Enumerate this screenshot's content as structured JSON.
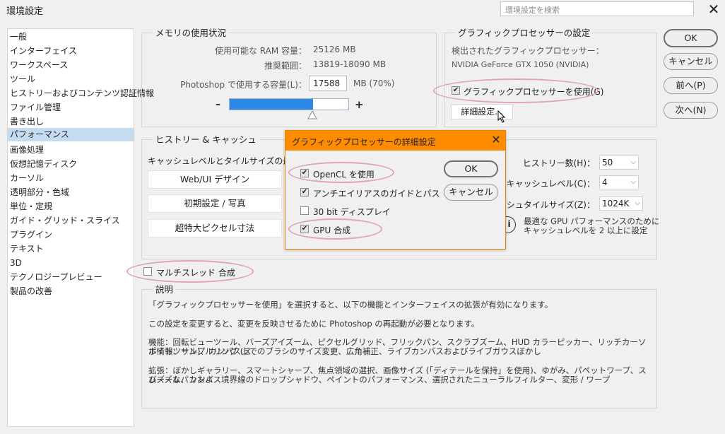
{
  "window": {
    "title": "環境設定",
    "search_placeholder": "環境設定を検索"
  },
  "sidebar": {
    "items": [
      {
        "label": "一般"
      },
      {
        "label": "インターフェイス"
      },
      {
        "label": "ワークスペース"
      },
      {
        "label": "ツール"
      },
      {
        "label": "ヒストリーおよびコンテンツ認証情報"
      },
      {
        "label": "ファイル管理"
      },
      {
        "label": "書き出し"
      },
      {
        "label": "パフォーマンス",
        "selected": true
      },
      {
        "label": "画像処理"
      },
      {
        "label": "仮想記憶ディスク"
      },
      {
        "label": "カーソル"
      },
      {
        "label": "透明部分・色域"
      },
      {
        "label": "単位・定規"
      },
      {
        "label": "ガイド・グリッド・スライス"
      },
      {
        "label": "プラグイン"
      },
      {
        "label": "テキスト"
      },
      {
        "label": "3D"
      },
      {
        "label": "テクノロジープレビュー"
      },
      {
        "label": "製品の改善"
      }
    ]
  },
  "memory": {
    "title": "メモリの使用状況",
    "available_label": "使用可能な RAM 容量：",
    "available_value": "25126 MB",
    "range_label": "推奨範囲：",
    "range_value": "13819-18090 MB",
    "use_label": "Photoshop で使用する容量(L)：",
    "use_value": "17588",
    "use_unit": "MB (70%)",
    "minus": "–",
    "plus": "+",
    "slider_fraction": 0.7
  },
  "gpu": {
    "title": "グラフィックプロセッサーの設定",
    "detected_label": "検出されたグラフィックプロセッサー：",
    "device": "NVIDIA GeForce GTX 1050 (NVIDIA)",
    "use_gpu_label": "グラフィックプロセッサーを使用(G)",
    "use_gpu_checked": true,
    "advanced_button": "詳細設定..."
  },
  "history": {
    "title": "ヒストリー & キャッシュ",
    "intro": "キャッシュレベルとタイルサイズの最適",
    "buttons": [
      "Web/UI デザイン",
      "初期設定 / 写真",
      "超特大ピクセル寸法"
    ],
    "states_label": "ヒストリー数(H)：",
    "states_value": "50",
    "cache_levels_label": "キャッシュレベル(C)：",
    "cache_levels_value": "4",
    "tile_size_label": "ャッシュタイルサイズ(Z)：",
    "tile_size_value": "1024K",
    "info_icon_glyph": "i",
    "gpu_note_1": "最適な GPU パフォーマンスのために",
    "gpu_note_2": "キャッシュレベルを 2 以上に設定"
  },
  "multithread": {
    "label": "マルチスレッド 合成",
    "checked": false
  },
  "description": {
    "title": "説明",
    "lines": [
      "「グラフィックプロセッサーを使用」を選択すると、以下の機能とインターフェイスの拡張が有効になります。",
      "この設定を変更すると、変更を反映させるために Photoshop の再起動が必要となります。",
      "機能：回転ビューツール、バーズアイズーム、ピクセルグリッド、フリックパン、スクラブズーム、HUD カラーピッカー、リッチカーソル情報、サンプルリング (ス",
      "ポイトツール)、カンバス上でのブラシのサイズ変更、広角補正、ライブカンバスおよびライブガウスぼかし",
      "拡張：ぼかしギャラリー、スマートシャープ、焦点領域の選択、画像サイズ (「ディテールを保持」を使用)、ゆがみ、パペットワープ、スムーズなパンおよ",
      "びズーム、カンバス境界線のドロップシャドウ、ペイントのパフォーマンス、選択されたニューラルフィルター、変形 / ワープ"
    ]
  },
  "buttons": {
    "ok": "OK",
    "cancel": "キャンセル",
    "prev": "前へ(P)",
    "next": "次へ(N)"
  },
  "dialog": {
    "title": "グラフィックプロセッサーの詳細設定",
    "options": [
      {
        "label": "OpenCL を使用",
        "checked": true
      },
      {
        "label": "アンチエイリアスのガイドとパス",
        "checked": true
      },
      {
        "label": "30 bit ディスプレイ",
        "checked": false
      },
      {
        "label": "GPU 合成",
        "checked": true
      }
    ],
    "ok": "OK",
    "cancel": "キャンセル"
  },
  "colors": {
    "accent": "#ff8c00",
    "highlight": "#e2a1c2",
    "slider_fill": "#2d8ae4",
    "selection": "#c5dcf0"
  }
}
